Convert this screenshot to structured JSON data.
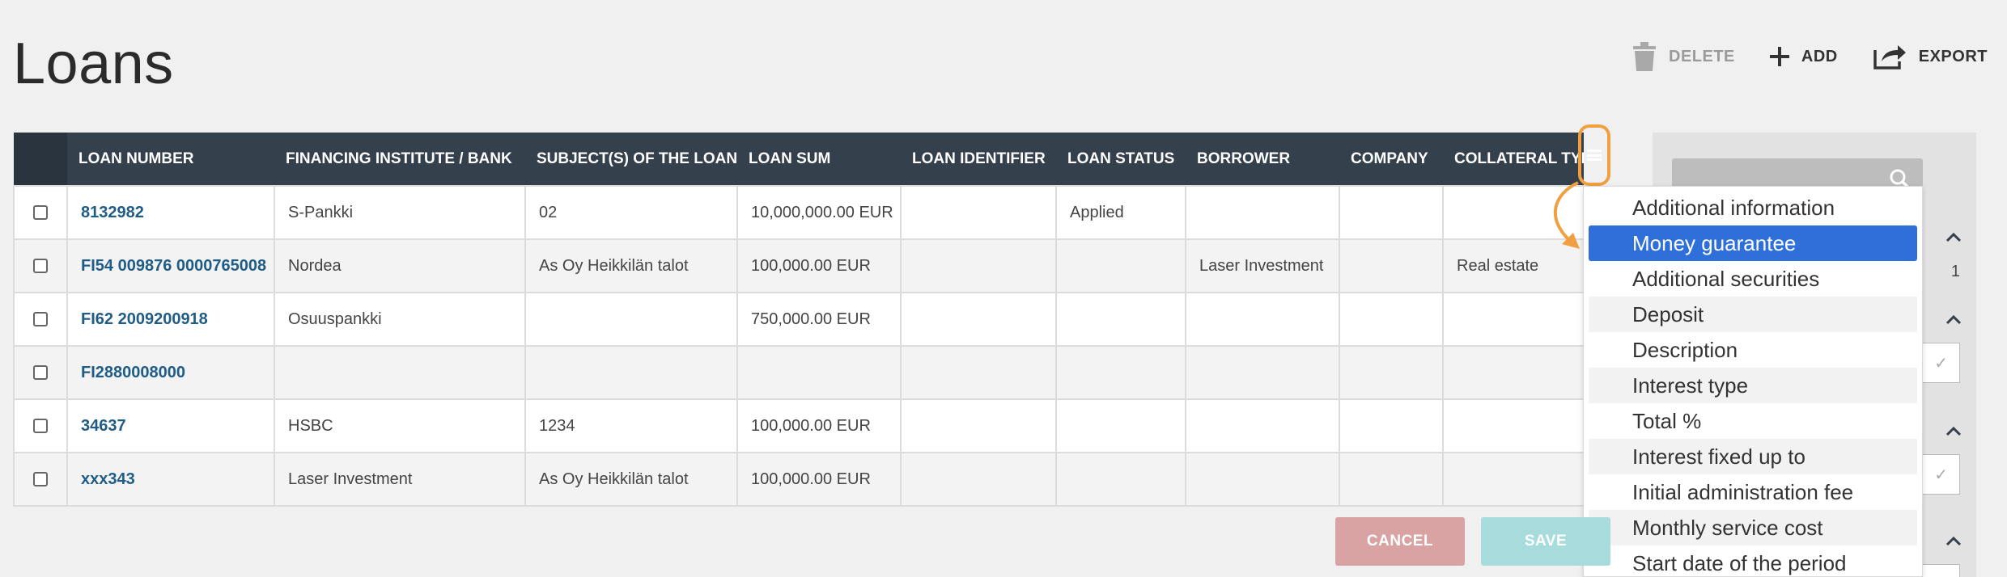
{
  "page": {
    "title": "Loans"
  },
  "toolbar": {
    "delete_label": "DELETE",
    "add_label": "ADD",
    "export_label": "EXPORT"
  },
  "table": {
    "columns": [
      "LOAN NUMBER",
      "FINANCING INSTITUTE / BANK",
      "SUBJECT(S) OF THE LOAN",
      "LOAN SUM",
      "LOAN IDENTIFIER",
      "LOAN STATUS",
      "BORROWER",
      "COMPANY",
      "COLLATERAL TYPE"
    ],
    "rows": [
      {
        "loan_number": "8132982",
        "bank": "S-Pankki",
        "subject": "02",
        "sum": "10,000,000.00 EUR",
        "identifier": "",
        "status": "Applied",
        "borrower": "",
        "company": "",
        "collateral": ""
      },
      {
        "loan_number": "FI54 009876 0000765008",
        "bank": "Nordea",
        "subject": "As Oy Heikkilän talot",
        "sum": "100,000.00 EUR",
        "identifier": "",
        "status": "",
        "borrower": "Laser Investment",
        "company": "",
        "collateral": "Real estate"
      },
      {
        "loan_number": "FI62 2009200918",
        "bank": "Osuuspankki",
        "subject": "",
        "sum": "750,000.00 EUR",
        "identifier": "",
        "status": "",
        "borrower": "",
        "company": "",
        "collateral": ""
      },
      {
        "loan_number": "FI2880008000",
        "bank": "",
        "subject": "",
        "sum": "",
        "identifier": "",
        "status": "",
        "borrower": "",
        "company": "",
        "collateral": ""
      },
      {
        "loan_number": "34637",
        "bank": "HSBC",
        "subject": "1234",
        "sum": "100,000.00 EUR",
        "identifier": "",
        "status": "",
        "borrower": "",
        "company": "",
        "collateral": ""
      },
      {
        "loan_number": "xxx343",
        "bank": "Laser Investment",
        "subject": "As Oy Heikkilän talot",
        "sum": "100,000.00 EUR",
        "identifier": "",
        "status": "",
        "borrower": "",
        "company": "",
        "collateral": ""
      }
    ]
  },
  "column_menu": {
    "icon": "hamburger-menu-icon",
    "items": [
      "Additional information",
      "Money guarantee",
      "Additional securities",
      "Deposit",
      "Description",
      "Interest type",
      "Total %",
      "Interest fixed up to",
      "Initial administration fee",
      "Monthly service cost",
      "Start date of the period"
    ],
    "selected": "Money guarantee"
  },
  "right_panel": {
    "count": "1"
  },
  "footer": {
    "cancel_label": "CANCEL",
    "save_label": "SAVE"
  },
  "colors": {
    "header_bg": "#34404c",
    "link": "#1f5c86",
    "highlight": "#f0a040",
    "selected": "#2e6fd9"
  }
}
